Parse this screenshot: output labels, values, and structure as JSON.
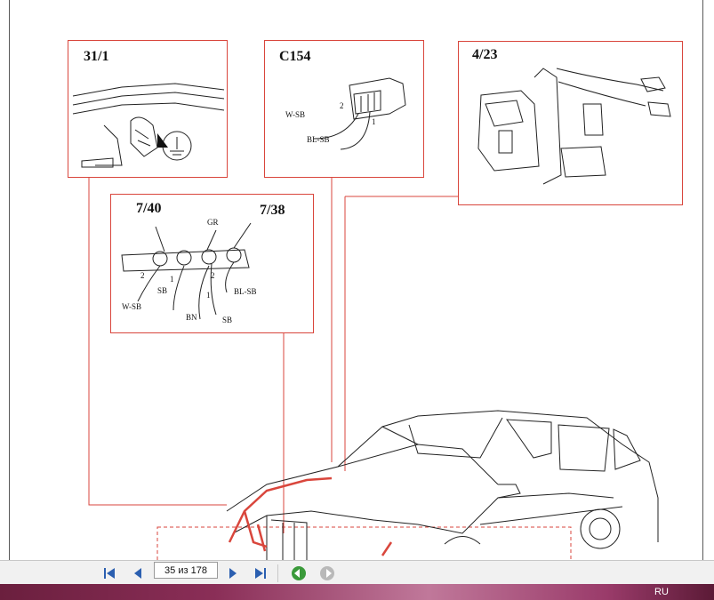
{
  "diagram": {
    "panels": [
      {
        "id": "31/1",
        "label": "31/1"
      },
      {
        "id": "C154",
        "label": "C154",
        "wires": [
          "W-SB",
          "BL-SB"
        ],
        "pins": [
          "2",
          "1"
        ]
      },
      {
        "id": "4/23",
        "label": "4/23"
      }
    ],
    "combo_panel": {
      "left_label": "7/40",
      "right_label": "7/38",
      "wires": [
        "GR",
        "SB",
        "W-SB",
        "BN",
        "SB",
        "BL-SB"
      ],
      "pins": [
        "2",
        "1",
        "2",
        "1"
      ]
    }
  },
  "viewer": {
    "page_field": "35 из 178",
    "buttons": [
      "first-page",
      "previous-page",
      "next-page",
      "last-page",
      "go-back",
      "go-forward"
    ]
  },
  "taskbar": {
    "language": "RU"
  }
}
